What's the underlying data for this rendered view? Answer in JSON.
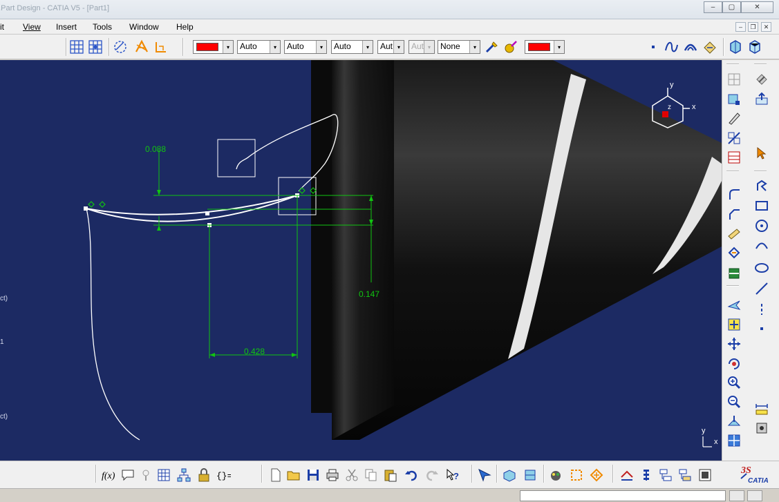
{
  "window": {
    "title": "...Part Design - CATIA V5 - [Part1]",
    "controls": {
      "minimize": "–",
      "restore": "▢",
      "close": "✕"
    },
    "mdi_controls": {
      "minimize": "–",
      "restore": "❐",
      "close": "✕"
    }
  },
  "menu": {
    "items": [
      {
        "label": "it"
      },
      {
        "label": "View"
      },
      {
        "label": "Insert"
      },
      {
        "label": "Tools"
      },
      {
        "label": "Window"
      },
      {
        "label": "Help"
      }
    ]
  },
  "toolbar": {
    "fill_color": "#ff0000",
    "line_color": "#ff0000",
    "transparency": "Auto",
    "line_thickness": "Auto",
    "line_type": "Auto",
    "point_type": "Aut",
    "layer_disabled": "Aut",
    "layer": "None",
    "arrow": "▾"
  },
  "viewport": {
    "background": "#1c2a63",
    "dimension_color": "#11c411",
    "dimensions": {
      "vertical_small": "0.088",
      "vertical_large": "0.147",
      "horizontal": "0.428"
    },
    "edge_labels": [
      "ct)",
      "1",
      "ct)"
    ],
    "compass": {
      "x_axis": "x",
      "y_axis": "y",
      "z_axis": "z"
    },
    "axis_triad": {
      "x_axis": "x",
      "y_axis": "y"
    }
  },
  "status": {
    "command_value": ""
  },
  "icons": {
    "top": [
      "grid-icon",
      "snap-icon",
      "construction-icon",
      "autodetect-icon",
      "dimension-constraint-icon",
      "paint-brush-icon",
      "properties-icon",
      "dot-icon",
      "spline-icon",
      "arc-icon",
      "sketch-icon",
      "workbench-icon",
      "part-icon"
    ],
    "right": [
      "sketch-tools-icon",
      "exit-sketch-icon",
      "profile-icon",
      "rectangle-icon",
      "circle-icon",
      "ellipse-icon",
      "line-icon",
      "point-icon",
      "fly-mode-icon",
      "fit-all-icon",
      "pan-icon",
      "rotate-icon",
      "zoom-in-icon",
      "zoom-out-icon",
      "normal-view-icon",
      "multi-view-icon",
      "measure-icon",
      "catia-logo"
    ],
    "bottom": [
      "formula-icon",
      "comment-icon",
      "knowledge-icon",
      "table-icon",
      "hierarchy-icon",
      "lock-icon",
      "bracket-icon",
      "new-icon",
      "open-icon",
      "save-icon",
      "print-icon",
      "cut-icon",
      "copy-icon",
      "paste-icon",
      "undo-icon",
      "redo-icon",
      "whats-this-icon",
      "fly-icon",
      "view-mode-icon",
      "quick-view-icon",
      "render-icon",
      "analysis-icon",
      "workbench-switch-icon",
      "stack-icon",
      "spec-tree-icon",
      "tree-icon",
      "ortho-icon"
    ]
  }
}
